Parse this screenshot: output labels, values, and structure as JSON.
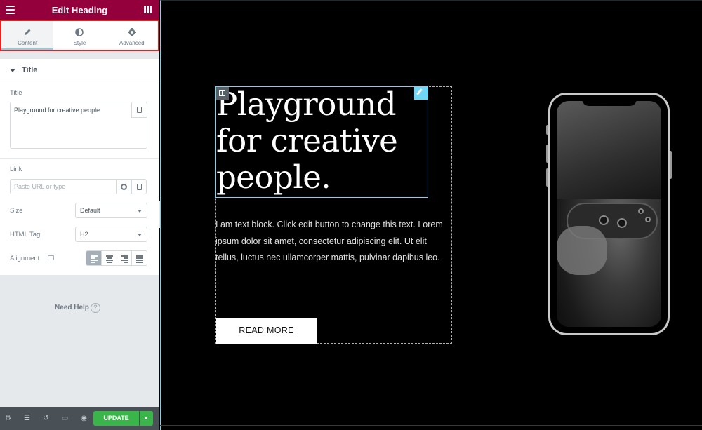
{
  "panel": {
    "title": "Edit Heading",
    "tabs": [
      {
        "label": "Content",
        "icon": "pencil-icon",
        "active": true
      },
      {
        "label": "Style",
        "icon": "half-circle-icon",
        "active": false
      },
      {
        "label": "Advanced",
        "icon": "gear-icon",
        "active": false
      }
    ],
    "section_title": "Title",
    "fields": {
      "title_label": "Title",
      "title_value": "Playground for creative people.",
      "link_label": "Link",
      "link_placeholder": "Paste URL or type",
      "size_label": "Size",
      "size_value": "Default",
      "html_tag_label": "HTML Tag",
      "html_tag_value": "H2",
      "alignment_label": "Alignment",
      "alignment_selected": "left"
    },
    "help_text": "Need Help",
    "help_icon": "?",
    "footer": {
      "update_label": "UPDATE"
    },
    "accent_color": "#93003c",
    "update_color": "#39b54a"
  },
  "canvas": {
    "heading": "Playground for creative people.",
    "body": "I am text block. Click edit button to change this text. Lorem ipsum dolor sit amet, consectetur adipiscing elit. Ut elit tellus, luctus nec ullamcorper mattis, pulvinar dapibus leo.",
    "button_label": "READ MORE",
    "selection_color": "#71d7f7"
  }
}
